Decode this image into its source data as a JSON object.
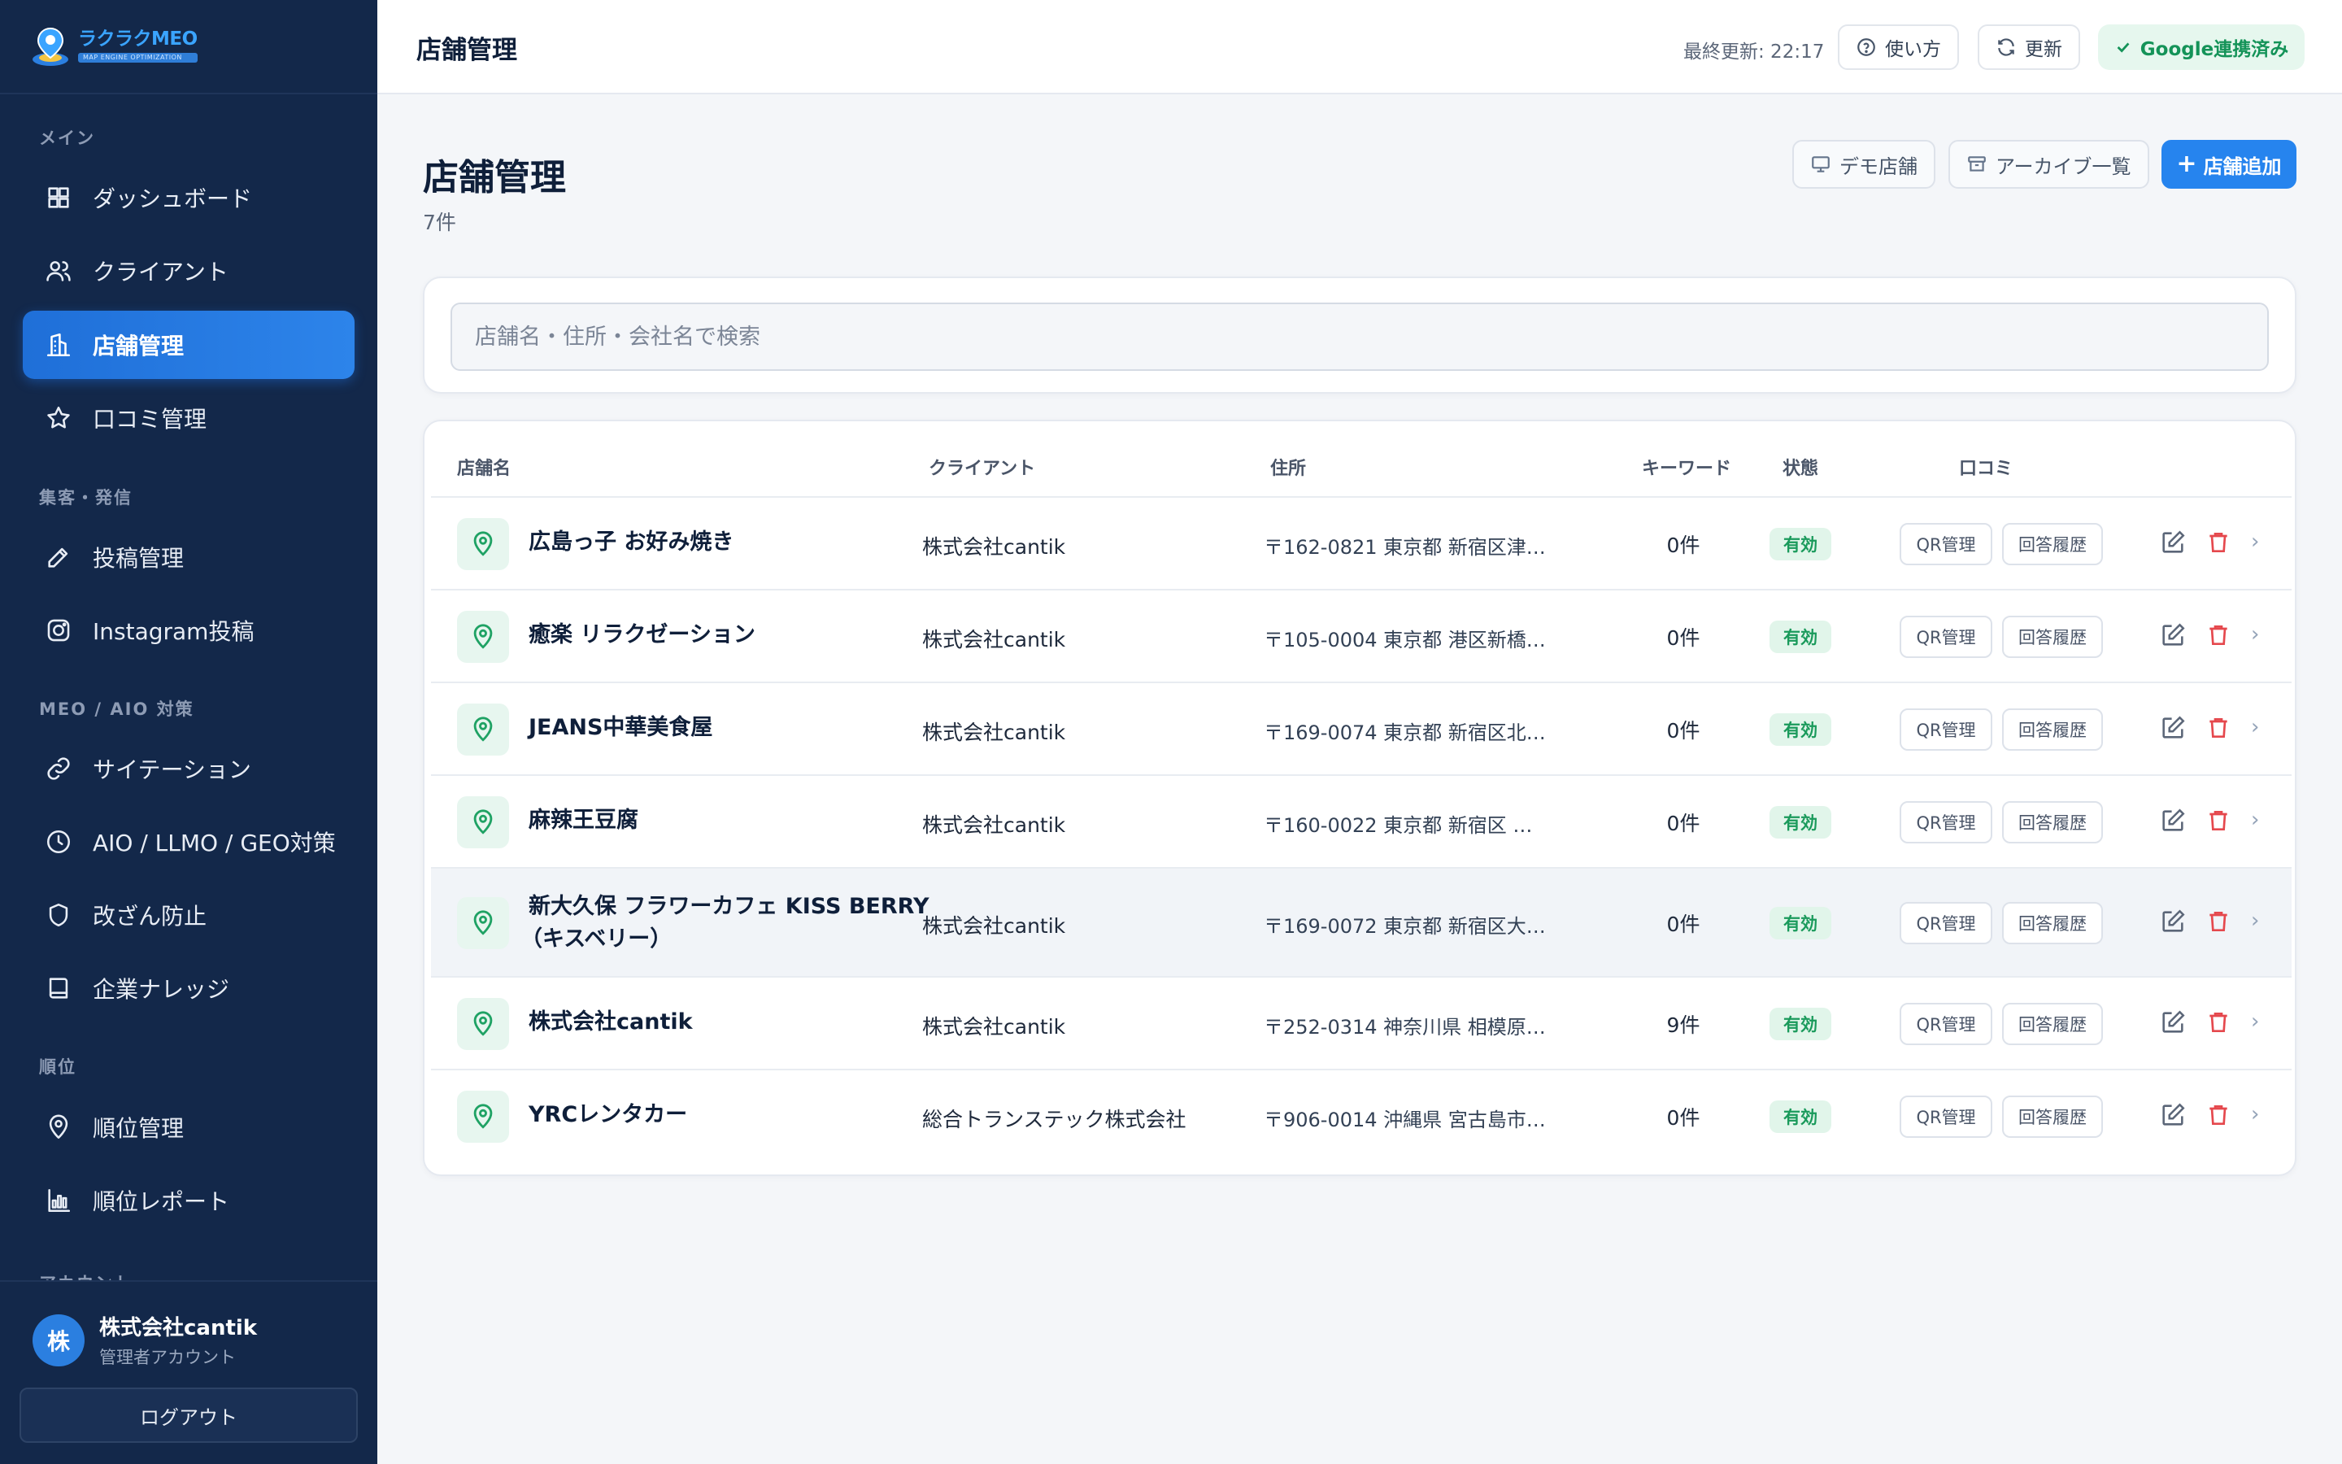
{
  "app": {
    "logo_name": "ラクラクMEO",
    "logo_sub": "MAP ENGINE OPTIMIZATION"
  },
  "sidebar": {
    "sections": [
      {
        "label": "メイン",
        "items": [
          {
            "label": "ダッシュボード",
            "icon": "grid-icon"
          },
          {
            "label": "クライアント",
            "icon": "users-icon"
          },
          {
            "label": "店舗管理",
            "icon": "building-icon",
            "active": true
          },
          {
            "label": "口コミ管理",
            "icon": "star-icon"
          }
        ]
      },
      {
        "label": "集客・発信",
        "items": [
          {
            "label": "投稿管理",
            "icon": "pen-icon"
          },
          {
            "label": "Instagram投稿",
            "icon": "instagram-icon"
          }
        ]
      },
      {
        "label": "MEO / AIO 対策",
        "items": [
          {
            "label": "サイテーション",
            "icon": "link-icon"
          },
          {
            "label": "AIO / LLMO / GEO対策",
            "icon": "clock-icon"
          },
          {
            "label": "改ざん防止",
            "icon": "shield-icon"
          },
          {
            "label": "企業ナレッジ",
            "icon": "book-icon"
          }
        ]
      },
      {
        "label": "順位",
        "items": [
          {
            "label": "順位管理",
            "icon": "pin-icon"
          },
          {
            "label": "順位レポート",
            "icon": "bar-chart-icon"
          }
        ]
      },
      {
        "label": "アカウント",
        "items": []
      }
    ],
    "user": {
      "avatar": "株",
      "name": "株式会社cantik",
      "role": "管理者アカウント"
    },
    "logout_label": "ログアウト"
  },
  "topbar": {
    "title": "店舗管理",
    "last_update": "最終更新: 22:17",
    "help_label": "使い方",
    "refresh_label": "更新",
    "google_label": "Google連携済み"
  },
  "main": {
    "title": "店舗管理",
    "count": "7件",
    "demo_label": "デモ店舗",
    "archive_label": "アーカイブ一覧",
    "add_label": "店舗追加",
    "search_placeholder": "店舗名・住所・会社名で検索",
    "columns": {
      "name": "店舗名",
      "client": "クライアント",
      "address": "住所",
      "keyword": "キーワード",
      "status": "状態",
      "reviews": "口コミ"
    },
    "qr_label": "QR管理",
    "history_label": "回答履歴",
    "rows": [
      {
        "name": "広島っ子 お好み焼き",
        "name2": "",
        "client": "株式会社cantik",
        "address": "〒162-0821 東京都 新宿区津…",
        "keyword": "0件",
        "status": "有効"
      },
      {
        "name": "癒楽 リラクゼーション",
        "name2": "",
        "client": "株式会社cantik",
        "address": "〒105-0004 東京都 港区新橋…",
        "keyword": "0件",
        "status": "有効"
      },
      {
        "name": "JEANS中華美食屋",
        "name2": "",
        "client": "株式会社cantik",
        "address": "〒169-0074 東京都 新宿区北…",
        "keyword": "0件",
        "status": "有効"
      },
      {
        "name": "麻辣王豆腐",
        "name2": "",
        "client": "株式会社cantik",
        "address": "〒160-0022 東京都 新宿区 …",
        "keyword": "0件",
        "status": "有効"
      },
      {
        "name": "新大久保 フラワーカフェ KISS BERRY",
        "name2": "（キスベリー）",
        "client": "株式会社cantik",
        "address": "〒169-0072 東京都 新宿区大…",
        "keyword": "0件",
        "status": "有効"
      },
      {
        "name": "株式会社cantik",
        "name2": "",
        "client": "株式会社cantik",
        "address": "〒252-0314 神奈川県 相模原…",
        "keyword": "9件",
        "status": "有効"
      },
      {
        "name": "YRCレンタカー",
        "name2": "",
        "client": "総合トランステック株式会社",
        "address": "〒906-0014 沖縄県 宮古島市…",
        "keyword": "0件",
        "status": "有効"
      }
    ]
  },
  "colors": {
    "sidebar_bg": "#13284a",
    "accent": "#2684ee",
    "status_green": "#1a9a5b",
    "delete_red": "#e5484d"
  }
}
